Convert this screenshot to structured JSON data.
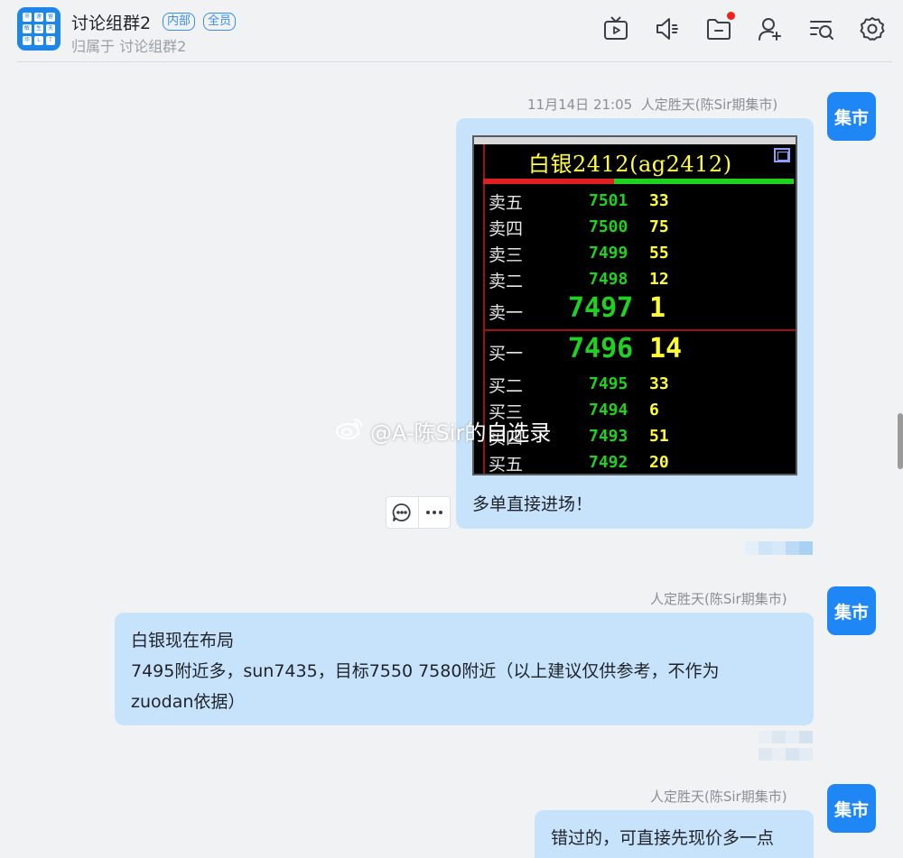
{
  "header": {
    "title": "讨论组群2",
    "badge_internal": "内部",
    "badge_all": "全员",
    "subtitle": "归属于 讨论组群2",
    "logo_cells": [
      "市",
      "速",
      "留",
      "敏",
      "生",
      "天",
      "华",
      "L",
      "T"
    ],
    "icons": [
      "tv-icon",
      "speaker-icon",
      "folder-icon",
      "add-user-icon",
      "search-list-icon",
      "settings-icon"
    ],
    "notification_dot_color": "#f0201a"
  },
  "messages": [
    {
      "time": "11月14日 21:05",
      "sender": "人定胜天(陈Sir期集市)",
      "avatar_text": "集市",
      "text": "多单直接进场！",
      "image": {
        "title": "白银2412(ag2412)",
        "asks": [
          {
            "label": "卖五",
            "price": "7501",
            "volume": "33"
          },
          {
            "label": "卖四",
            "price": "7500",
            "volume": "75"
          },
          {
            "label": "卖三",
            "price": "7499",
            "volume": "55"
          },
          {
            "label": "卖二",
            "price": "7498",
            "volume": "12"
          },
          {
            "label": "卖一",
            "price": "7497",
            "volume": "1"
          }
        ],
        "bids": [
          {
            "label": "买一",
            "price": "7496",
            "volume": "14"
          },
          {
            "label": "买二",
            "price": "7495",
            "volume": "33"
          },
          {
            "label": "买三",
            "price": "7494",
            "volume": "6"
          },
          {
            "label": "买四",
            "price": "7493",
            "volume": "51"
          },
          {
            "label": "买五",
            "price": "7492",
            "volume": "20"
          }
        ],
        "watermark": "@A-陈Sir的自选录"
      }
    },
    {
      "sender": "人定胜天(陈Sir期集市)",
      "avatar_text": "集市",
      "lines": [
        "白银现在布局",
        "7495附近多，sun7435，目标7550 7580附近（以上建议仅供参考，不作为",
        "zuodan依据）"
      ]
    },
    {
      "sender": "人定胜天(陈Sir期集市)",
      "avatar_text": "集市",
      "text": "错过的，可直接先现价多一点"
    }
  ],
  "colors": {
    "bubble": "#c7e3fb",
    "avatar": "#1e86f5",
    "accent": "#3a8ee6"
  }
}
